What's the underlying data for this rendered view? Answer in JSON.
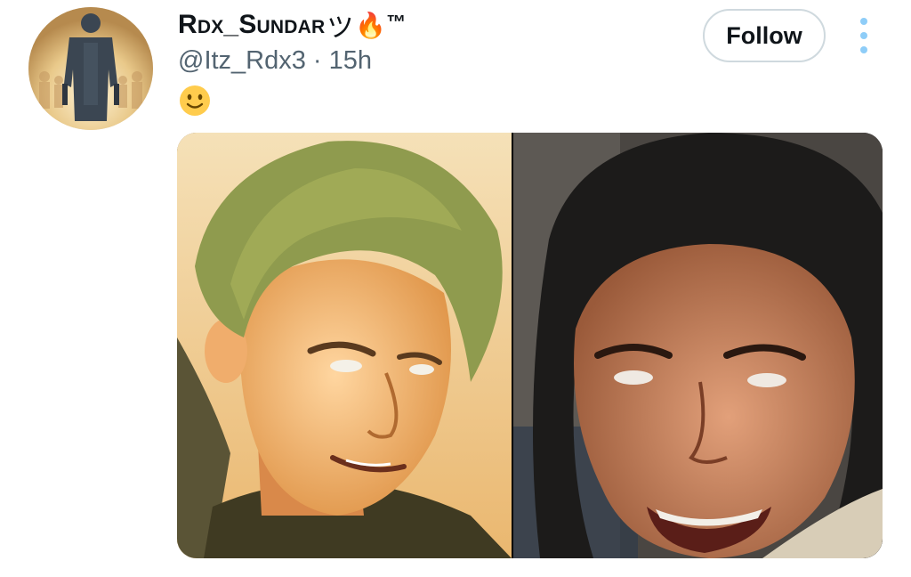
{
  "tweet": {
    "author": {
      "display_name": "Rdx_Sundar",
      "name_suffix": "ツ",
      "badge_emoji": "🔥",
      "trademark": "™",
      "handle": "@Itz_Rdx3",
      "separator": "·",
      "time": "15h",
      "avatar_icon": "avatar-photo"
    },
    "text_emoji": "🙂",
    "follow_label": "Follow",
    "more_icon": "more-dots-icon",
    "media": [
      {
        "label": "young man with dyed hair and white eyes, smirking"
      },
      {
        "label": "woman laughing with white eyes"
      }
    ]
  },
  "colors": {
    "text_primary": "#0f1419",
    "text_secondary": "#536471",
    "border": "#cfd9de",
    "accent": "#1d9bf0"
  }
}
